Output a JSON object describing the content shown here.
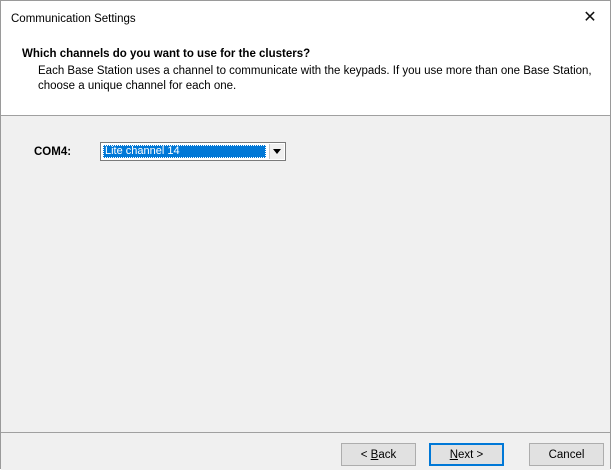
{
  "window": {
    "title": "Communication Settings",
    "close_glyph": "✕"
  },
  "header": {
    "title": "Which channels do you want to use for the clusters?",
    "description": "Each Base Station uses a channel to communicate with the keypads. If you use more than one Base Station, choose a unique channel for each one."
  },
  "channel": {
    "label": "COM4:",
    "selected": "Lite channel 14"
  },
  "buttons": {
    "back_prefix": "< ",
    "back_mnemonic": "B",
    "back_rest": "ack",
    "next_mnemonic": "N",
    "next_rest": "ext >",
    "cancel": "Cancel"
  },
  "colors": {
    "selection": "#0078d7",
    "dialog_bg": "#f0f0f0"
  }
}
